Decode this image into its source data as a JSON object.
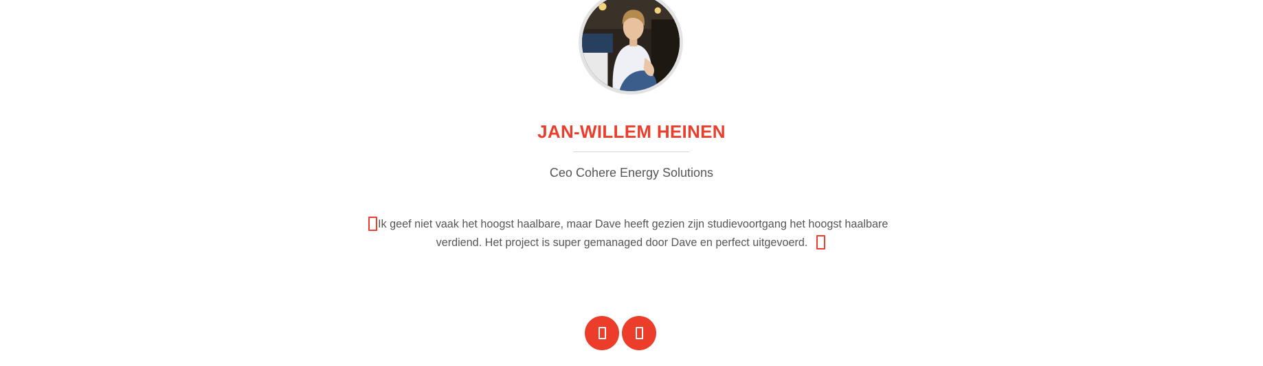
{
  "testimonial": {
    "name": "JAN-WILLEM HEINEN",
    "role": "Ceo Cohere Energy Solutions",
    "quote_line_1": "Ik geef niet vaak het hoogst haalbare, maar Dave heeft gezien zijn studievoortgang het hoogst haalbare",
    "quote_line_2": "verdiend. Het project is super gemanaged door Dave en perfect uitgevoerd.",
    "avatar_icon": "person-photo",
    "quote_open_icon": "quote-open-icon",
    "quote_close_icon": "quote-close-icon"
  },
  "carousel": {
    "prev_icon": "chevron-left-icon",
    "next_icon": "chevron-right-icon"
  },
  "colors": {
    "accent": "#ec3d2b",
    "text": "#555555",
    "divider": "#d6d6d6",
    "avatar_border": "#e3e3e3"
  }
}
